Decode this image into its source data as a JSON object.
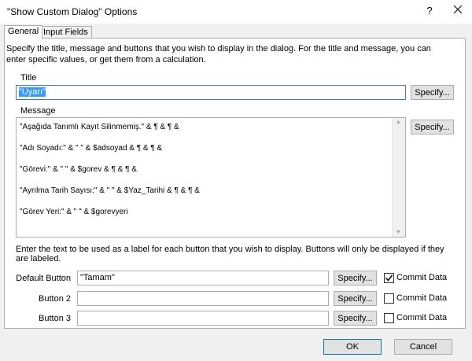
{
  "window": {
    "title": "\"Show Custom Dialog\" Options",
    "help_symbol": "?",
    "close_symbol": "✕"
  },
  "tabs": [
    {
      "label": "General"
    },
    {
      "label": "Input Fields"
    }
  ],
  "description": "Specify the title, message and buttons that you wish to display in the dialog.  For the title and message, you can enter specific values, or get them from a calculation.",
  "title_section": {
    "label": "Title",
    "value": "\"Uyarı\"",
    "specify_label": "Specify..."
  },
  "message_section": {
    "label": "Message",
    "specify_label": "Specify...",
    "lines": [
      "\"Aşağıda Tanımlı Kayıt Silinmemiş.\" & ¶ & ¶ &",
      "\"Adı Soyadı:\" & \" \" & $adsoyad & ¶ & ¶ &",
      "\"Görevi:\" & \" \" & $gorev & ¶ & ¶ &",
      "\"Ayrılma Tarih Sayısı:\" & \" \" & $Yaz_Tarihi & ¶ & ¶ &",
      "\"Görev Yeri:\" & \" \" & $gorevyeri"
    ]
  },
  "buttons_instruction": "Enter the text to be used as a label for each button that you wish to display. Buttons will only be displayed if they are labeled.",
  "button_rows": [
    {
      "label": "Default Button",
      "value": "\"Tamam\"",
      "specify_label": "Specify...",
      "commit_label": "Commit Data",
      "commit_checked": true
    },
    {
      "label": "Button 2",
      "value": "",
      "specify_label": "Specify...",
      "commit_label": "Commit Data",
      "commit_checked": false
    },
    {
      "label": "Button 3",
      "value": "",
      "specify_label": "Specify...",
      "commit_label": "Commit Data",
      "commit_checked": false
    }
  ],
  "footer": {
    "ok_label": "OK",
    "cancel_label": "Cancel"
  }
}
